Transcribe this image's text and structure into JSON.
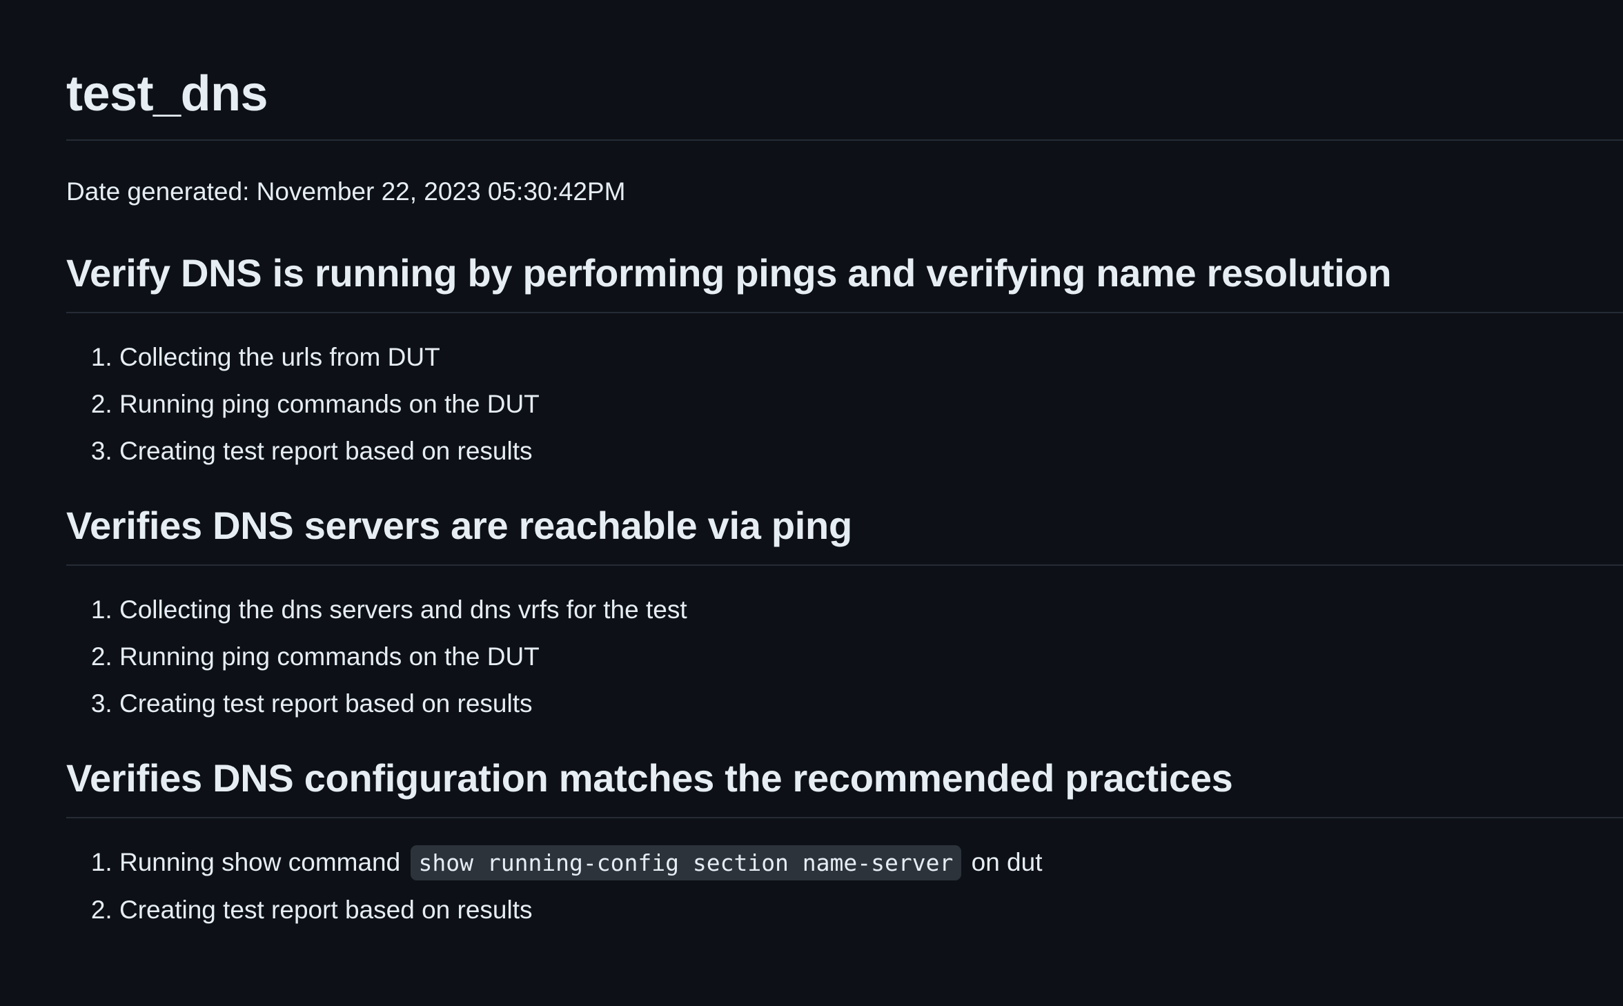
{
  "page": {
    "title": "test_dns",
    "date_line": "Date generated: November 22, 2023 05:30:42PM"
  },
  "sections": [
    {
      "heading": "Verify DNS is running by performing pings and verifying name resolution",
      "steps": [
        "Collecting the urls from DUT",
        "Running ping commands on the DUT",
        "Creating test report based on results"
      ]
    },
    {
      "heading": "Verifies DNS servers are reachable via ping",
      "steps": [
        "Collecting the dns servers and dns vrfs for the test",
        "Running ping commands on the DUT",
        "Creating test report based on results"
      ]
    },
    {
      "heading": "Verifies DNS configuration matches the recommended practices",
      "step1": {
        "prefix": "Running show command",
        "code": "show running-config section name-server",
        "suffix": "on dut"
      },
      "step2": "Creating test report based on results"
    }
  ]
}
